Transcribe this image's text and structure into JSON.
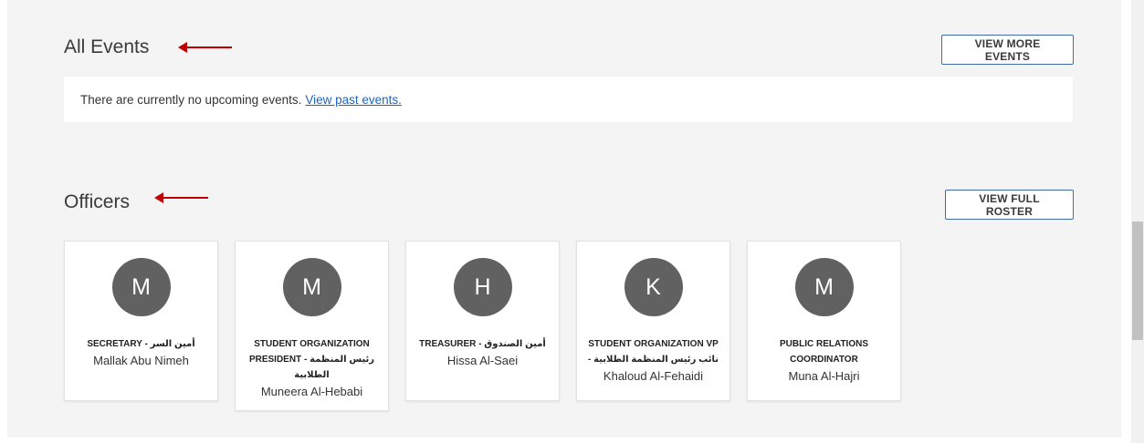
{
  "events": {
    "title": "All Events",
    "view_more_label": "VIEW MORE EVENTS",
    "empty_text": "There are currently no upcoming events.",
    "past_link": "View past events."
  },
  "officers": {
    "title": "Officers",
    "view_roster_label": "VIEW FULL ROSTER",
    "items": [
      {
        "initial": "M",
        "role": "SECRETARY - أمين السر",
        "name": "Mallak Abu Nimeh"
      },
      {
        "initial": "M",
        "role": "STUDENT ORGANIZATION PRESIDENT - رئيس المنظمة الطلابية",
        "name": "Muneera Al-Hebabi"
      },
      {
        "initial": "H",
        "role": "TREASURER - أمين الصندوق",
        "name": "Hissa Al-Saei"
      },
      {
        "initial": "K",
        "role": "STUDENT ORGANIZATION VP - نائب رئيس المنظمة الطلابية",
        "name": "Khaloud Al-Fehaidi"
      },
      {
        "initial": "M",
        "role": "PUBLIC RELATIONS COORDINATOR",
        "name": "Muna Al-Hajri"
      }
    ]
  },
  "colors": {
    "annotation_arrow": "#c00000",
    "avatar": "#616161",
    "link": "#1a66c4",
    "button_border": "#3f6cab"
  }
}
